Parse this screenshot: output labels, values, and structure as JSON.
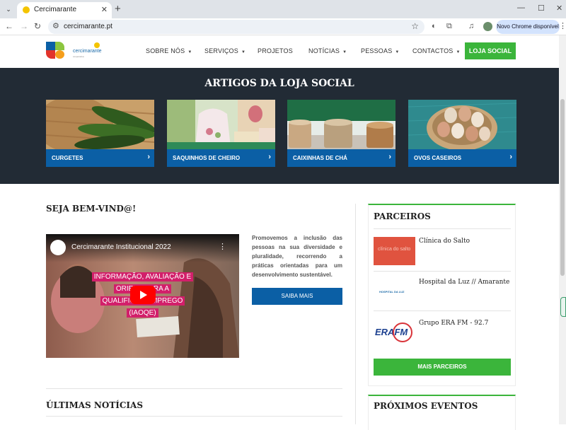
{
  "browser": {
    "tab_title": "Cercimarante",
    "url": "cercimarante.pt",
    "update_label": "Novo Chrome disponível"
  },
  "site": {
    "logo_text": "cercimarante",
    "logo_sub": "cooperativa",
    "nav": [
      "SOBRE NÓS",
      "SERVIÇOS",
      "PROJETOS",
      "NOTÍCIAS",
      "PESSOAS",
      "CONTACTOS"
    ],
    "cta": "LOJA SOCIAL",
    "accent_green": "#3bb53b",
    "accent_blue": "#0b5fa5"
  },
  "hero": {
    "title": "ARTIGOS DA LOJA SOCIAL",
    "cards": [
      {
        "label": "CURGETES"
      },
      {
        "label": "SAQUINHOS DE CHEIRO"
      },
      {
        "label": "CAIXINHAS DE CHÁ"
      },
      {
        "label": "OVOS CASEIROS"
      }
    ]
  },
  "main": {
    "welcome_title": "SEJA BEM-VIND@!",
    "video": {
      "title": "Cercimarante Institucional 2022",
      "caption_lines": [
        "INFORMAÇÃO, AVALIAÇÃO E",
        "ORIENT      PARA A",
        "QUALIFICAÇ      EMPREGO",
        "(IAOQE)"
      ]
    },
    "intro": "Promovemos a inclusão das pessoas na sua diversidade e pluralidade, recorrendo a práticas orientadas para um desenvolvimento sustentável.",
    "saiba_mais": "SAIBA MAIS",
    "news_title": "ÚLTIMAS NOTÍCIAS"
  },
  "sidebar": {
    "partners_title": "PARCEIROS",
    "partners": [
      {
        "name": "Clínica do Salto",
        "logo_text": "clínica do salto"
      },
      {
        "name": "Hospital da Luz // Amarante",
        "logo_text": "HOSPITAL DA LUZ"
      },
      {
        "name": "Grupo ERA FM - 92.7",
        "logo_text": "ERAFM"
      }
    ],
    "more_partners": "MAIS PARCEIROS",
    "events_title": "PRÓXIMOS EVENTOS"
  }
}
